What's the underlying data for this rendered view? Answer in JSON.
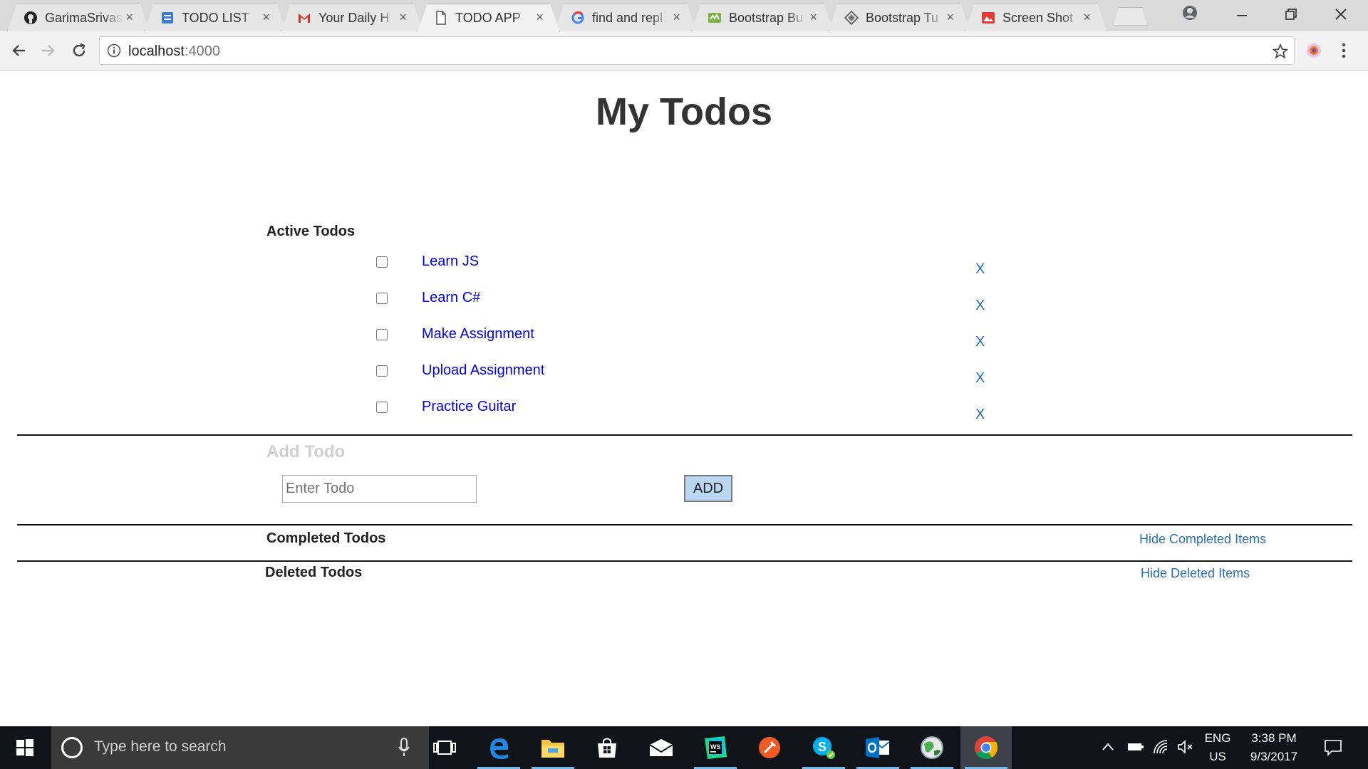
{
  "browser": {
    "tabs": [
      {
        "title": "GarimaSrivas",
        "icon": "github-icon",
        "active": false
      },
      {
        "title": "TODO LIST",
        "icon": "todo-list-favicon-icon",
        "active": false
      },
      {
        "title": "Your Daily H",
        "icon": "gmail-icon",
        "active": false
      },
      {
        "title": "TODO APP",
        "icon": "page-icon",
        "active": true
      },
      {
        "title": "find and repl",
        "icon": "google-icon",
        "active": false
      },
      {
        "title": "Bootstrap Bu",
        "icon": "bootstrap-builder-icon",
        "active": false
      },
      {
        "title": "Bootstrap Tu",
        "icon": "bootstrap-tutorial-icon",
        "active": false
      },
      {
        "title": "Screen Shot",
        "icon": "image-icon",
        "active": false
      }
    ],
    "close_glyph": "×",
    "url_host": "localhost",
    "url_port": ":4000"
  },
  "page": {
    "title": "My Todos",
    "active_heading": "Active Todos",
    "todos": [
      {
        "text": "Learn JS",
        "done": false
      },
      {
        "text": "Learn C#",
        "done": false
      },
      {
        "text": "Make Assignment",
        "done": false
      },
      {
        "text": "Upload Assignment",
        "done": false
      },
      {
        "text": "Practice Guitar",
        "done": false
      }
    ],
    "delete_label": "X",
    "add_heading": "Add Todo",
    "input_placeholder": "Enter Todo",
    "add_button": "ADD",
    "completed_heading": "Completed Todos",
    "hide_completed": "Hide Completed Items",
    "deleted_heading": "Deleted Todos",
    "hide_deleted": "Hide Deleted Items"
  },
  "taskbar": {
    "search_placeholder": "Type here to search",
    "apps": [
      "task-view-icon",
      "edge-icon",
      "file-explorer-icon",
      "store-icon",
      "mail-icon",
      "webstorm-icon",
      "postman-icon",
      "skype-icon",
      "outlook-icon",
      "globe-app-icon",
      "chrome-icon"
    ],
    "lang_top": "ENG",
    "lang_bottom": "US",
    "time": "3:38 PM",
    "date": "9/3/2017"
  },
  "colors": {
    "link": "#0000ee",
    "accent_link": "#2a6ebb",
    "add_button_bg": "#b9d7f3",
    "taskbar_bg": "#101418"
  }
}
